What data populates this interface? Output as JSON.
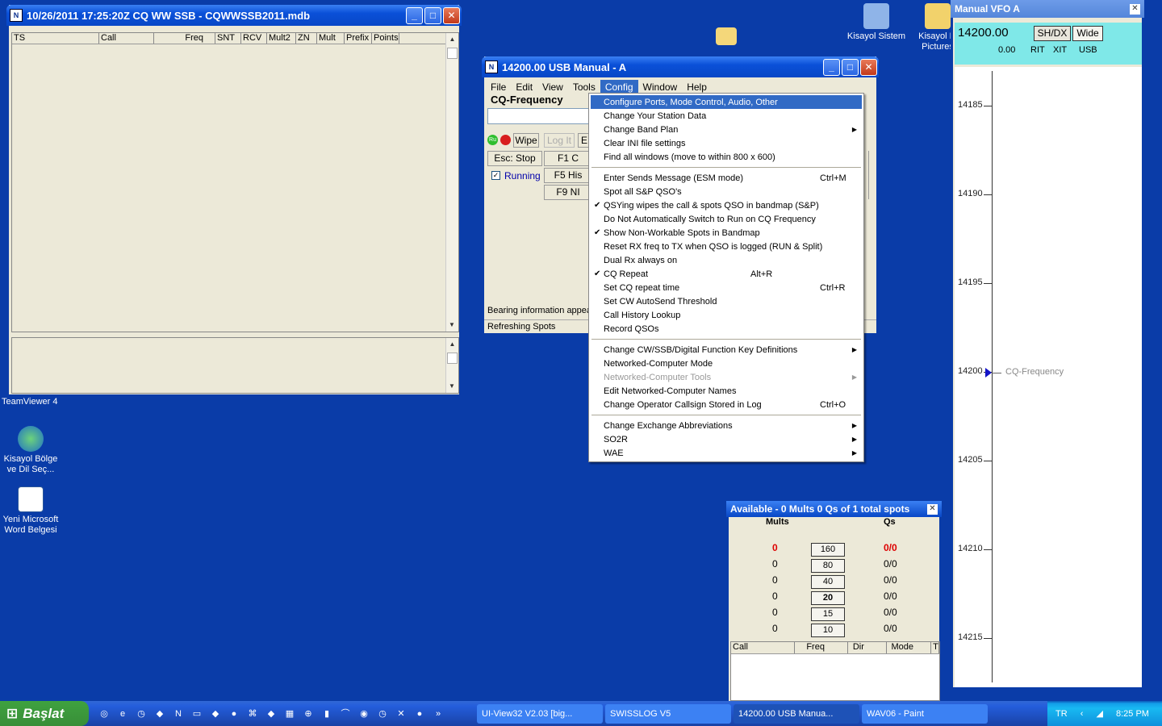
{
  "desktop_icons": [
    {
      "label": "Kisayol Sistem"
    },
    {
      "label": "Kisayol M Pictures"
    },
    {
      "label": "TeamViewer 4"
    },
    {
      "label": "Kisayol Bölge ve Dil Seç..."
    },
    {
      "label": "Yeni Microsoft Word Belgesi"
    }
  ],
  "log_window": {
    "title": "10/26/2011 17:25:20Z  CQ WW SSB - CQWWSSB2011.mdb",
    "columns": [
      "TS",
      "Call",
      "Freq",
      "SNT",
      "RCV",
      "Mult2",
      "ZN",
      "Mult",
      "Prefix",
      "Points"
    ]
  },
  "entry_window": {
    "title": "14200.00 USB Manual - A",
    "menu": [
      "File",
      "Edit",
      "View",
      "Tools",
      "Config",
      "Window",
      "Help"
    ],
    "group_label": "CQ-Frequency",
    "wipe": "Wipe",
    "log_it": "Log It",
    "e_btn": "E",
    "esc_stop": "Esc: Stop",
    "f1": "F1 C",
    "f5": "F5 His",
    "f9": "F9 NI",
    "running": "Running",
    "bearing": "Bearing information appear",
    "status": "Refreshing Spots"
  },
  "config_menu": {
    "items": [
      {
        "label": "Configure Ports, Mode Control, Audio, Other",
        "hl": true
      },
      {
        "label": "Change Your Station Data"
      },
      {
        "label": "Change Band Plan",
        "sub": true
      },
      {
        "label": "Clear INI file settings"
      },
      {
        "label": "Find all windows (move to within 800 x 600)"
      },
      {
        "sep": true
      },
      {
        "label": "Enter Sends Message (ESM mode)",
        "shortcut": "Ctrl+M"
      },
      {
        "label": "Spot all S&P QSO's"
      },
      {
        "label": "QSYing wipes the call & spots QSO in bandmap (S&P)",
        "checked": true
      },
      {
        "label": "Do Not Automatically Switch to Run on CQ Frequency"
      },
      {
        "label": "Show Non-Workable Spots in Bandmap",
        "checked": true
      },
      {
        "label": "Reset RX freq to TX when QSO is logged (RUN & Split)"
      },
      {
        "label": "Dual Rx always on"
      },
      {
        "label": "CQ Repeat",
        "checked": true,
        "shortcut": "Alt+R",
        "sc_mid": true
      },
      {
        "label": "Set CQ repeat time",
        "shortcut": "Ctrl+R"
      },
      {
        "label": "Set CW AutoSend Threshold"
      },
      {
        "label": "Call History Lookup"
      },
      {
        "label": "Record QSOs"
      },
      {
        "sep": true
      },
      {
        "label": "Change CW/SSB/Digital Function Key Definitions",
        "sub": true
      },
      {
        "label": "Networked-Computer Mode"
      },
      {
        "label": "Networked-Computer Tools",
        "sub": true,
        "disabled": true
      },
      {
        "label": "Edit Networked-Computer Names"
      },
      {
        "label": "Change Operator Callsign Stored in Log",
        "shortcut": "Ctrl+O"
      },
      {
        "sep": true
      },
      {
        "label": "Change Exchange Abbreviations",
        "sub": true
      },
      {
        "label": "SO2R",
        "sub": true
      },
      {
        "label": "WAE",
        "sub": true
      }
    ]
  },
  "available": {
    "title": "Available - 0 Mults 0 Qs of 1 total spots",
    "mults_h": "Mults",
    "qs_h": "Qs",
    "rows": [
      {
        "mult": "0",
        "band": "160",
        "qs": "0/0",
        "red": true
      },
      {
        "mult": "0",
        "band": "80",
        "qs": "0/0"
      },
      {
        "mult": "0",
        "band": "40",
        "qs": "0/0"
      },
      {
        "mult": "0",
        "band": "20",
        "qs": "0/0",
        "bold": true
      },
      {
        "mult": "0",
        "band": "15",
        "qs": "0/0"
      },
      {
        "mult": "0",
        "band": "10",
        "qs": "0/0"
      }
    ],
    "columns": [
      "Call",
      "Freq",
      "Dir",
      "Mode",
      "T"
    ]
  },
  "bandmap": {
    "title": "Manual VFO A",
    "freq": "14200.00",
    "shdx": "SH/DX",
    "wide": "Wide",
    "rit_val": "0.00",
    "rit": "RIT",
    "xit": "XIT",
    "mode": "USB",
    "ticks": [
      "14185",
      "14190",
      "14195",
      "14200",
      "14205",
      "14210",
      "14215"
    ],
    "marker": "CQ-Frequency"
  },
  "taskbar": {
    "start": "Başlat",
    "tasks": [
      "UI-View32 V2.03 [big...",
      "SWISSLOG V5",
      "14200.00 USB Manua...",
      "WAV06 - Paint"
    ],
    "lang": "TR",
    "clock": "8:25 PM"
  }
}
